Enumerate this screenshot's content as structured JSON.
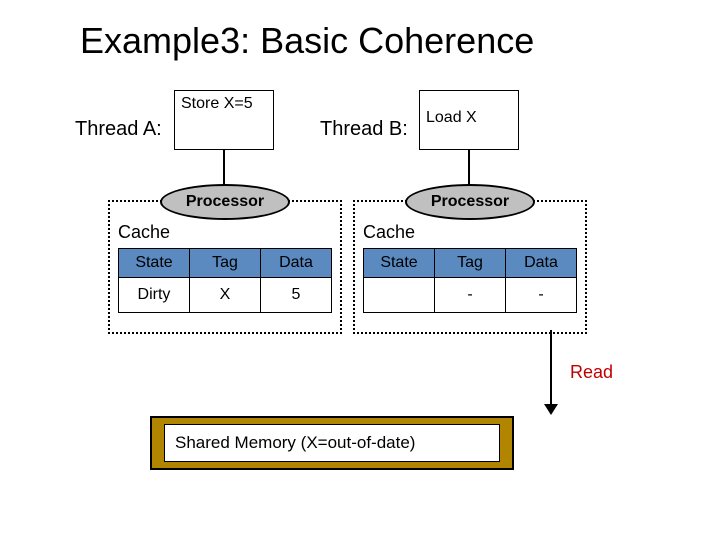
{
  "title": "Example3: Basic Coherence",
  "threadA": {
    "label": "Thread A:",
    "line1": "Store X=5",
    "line2": ""
  },
  "threadB": {
    "label": "Thread B:",
    "line1": "",
    "line2": "Load X"
  },
  "processor": "Processor",
  "cacheLabel": "Cache",
  "headers": {
    "state": "State",
    "tag": "Tag",
    "data": "Data"
  },
  "coreA": {
    "state": "Dirty",
    "tag": "X",
    "data": "5"
  },
  "coreB": {
    "state": "",
    "tag": "-",
    "data": "-"
  },
  "readLabel": "Read",
  "memory": "Shared Memory (X=out-of-date)",
  "chart_data": {
    "type": "table",
    "title": "Basic Coherence — two private caches + shared memory",
    "cores": [
      {
        "thread": "A",
        "instructions": [
          "Store X=5"
        ],
        "cache": {
          "state": "Dirty",
          "tag": "X",
          "data": 5
        }
      },
      {
        "thread": "B",
        "instructions": [
          "Load X"
        ],
        "cache": {
          "state": null,
          "tag": null,
          "data": null
        }
      }
    ],
    "shared_memory": {
      "X": "out-of-date"
    },
    "bus_event": {
      "origin": "B",
      "type": "Read"
    }
  }
}
